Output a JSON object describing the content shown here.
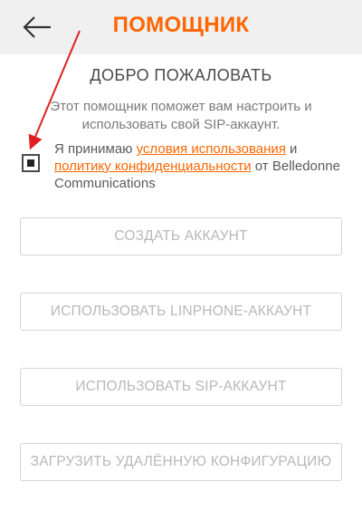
{
  "header": {
    "title": "ПОМОЩНИК",
    "back_icon": "arrow-left-icon",
    "accent_color": "#ff6600"
  },
  "welcome": {
    "title": "ДОБРО ПОЖАЛОВАТЬ",
    "description": "Этот помощник поможет вам настроить и использовать свой SIP-аккаунт."
  },
  "terms": {
    "checkbox_checked": true,
    "prefix": "Я принимаю ",
    "terms_link": "условия использования",
    "middle": " и ",
    "privacy_link": "политику конфиденциальности",
    "suffix": " от Belledonne Communications"
  },
  "buttons": {
    "create_account": "СОЗДАТЬ АККАУНТ",
    "use_linphone": "ИСПОЛЬЗОВАТЬ LINPHONE-АККАУНТ",
    "use_sip": "ИСПОЛЬЗОВАТЬ SIP-АККАУНТ",
    "remote_config": "ЗАГРУЗИТЬ УДАЛЁННУЮ КОНФИГУРАЦИЮ"
  },
  "annotation": {
    "arrow_color": "#e02020"
  }
}
